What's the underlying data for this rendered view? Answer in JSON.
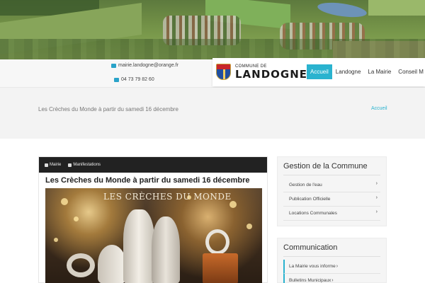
{
  "header": {
    "email": "mairie.landogne@orange.fr",
    "phone": "04 73 79 82 60",
    "logo_small": "COMMUNE DE",
    "logo_big": "LANDOGNE",
    "nav": [
      {
        "label": "Accueil",
        "active": true
      },
      {
        "label": "Landogne",
        "active": false
      },
      {
        "label": "La Mairie",
        "active": false
      },
      {
        "label": "Conseil M",
        "active": false
      }
    ]
  },
  "breadcrumb": {
    "page_title": "Les Crèches du Monde à partir du samedi 16 décembre",
    "home": "Accueil"
  },
  "post": {
    "meta": [
      "Mairie",
      "Manifestations"
    ],
    "title": "Les Crèches du Monde à partir du samedi 16 décembre",
    "image_caption": "LES CRÈCHES DU MONDE"
  },
  "sidebar": {
    "gestion": {
      "title": "Gestion de la Commune",
      "items": [
        "Gestion de l'eau",
        "Publication Officielle",
        "Locations Communales"
      ]
    },
    "communication": {
      "title": "Communication",
      "items": [
        "La Mairie vous informe",
        "Bulletins Municipaux"
      ]
    }
  },
  "icons": {
    "email": "envelope-icon",
    "phone": "phone-icon",
    "meta_author": "user-icon",
    "meta_category": "folder-icon",
    "chevron": "chevron-right-icon"
  },
  "colors": {
    "accent": "#2ab3cf",
    "meta_bar": "#222222"
  }
}
